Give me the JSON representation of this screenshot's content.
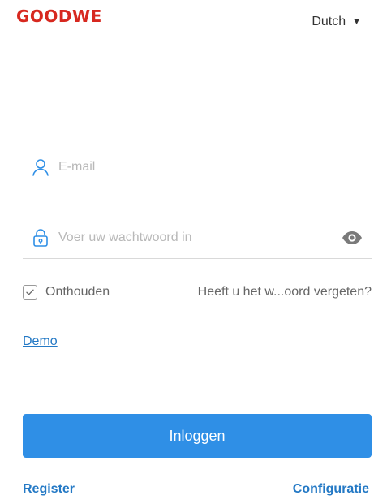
{
  "header": {
    "logo_text": "GOODWE",
    "language": "Dutch"
  },
  "form": {
    "email_placeholder": "E-mail",
    "password_placeholder": "Voer uw wachtwoord in",
    "remember_label": "Onthouden",
    "forgot_label": "Heeft u het w...oord vergeten?",
    "demo_label": "Demo",
    "login_label": "Inloggen"
  },
  "footer": {
    "register_label": "Register",
    "config_label": "Configuratie"
  },
  "icons": {
    "user": "user-icon",
    "lock": "lock-icon",
    "eye": "eye-icon",
    "check": "check-icon",
    "caret": "caret-down-icon"
  },
  "colors": {
    "brand": "#d7281f",
    "accent": "#2f8fe6",
    "link": "#2479c5"
  }
}
